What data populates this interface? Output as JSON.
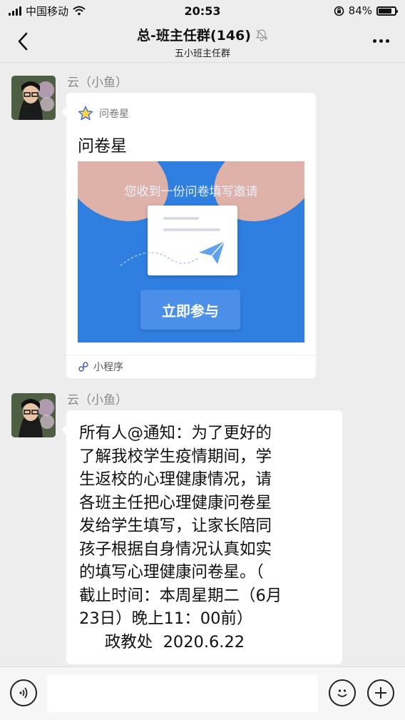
{
  "status_bar": {
    "carrier": "中国移动",
    "time": "20:53",
    "battery_percent": "84%",
    "battery_level": 0.84
  },
  "header": {
    "title": "总-班主任群(146)",
    "subtitle": "五小班主任群"
  },
  "messages": [
    {
      "sender": "云（小鱼）",
      "type": "mini_program",
      "app_name": "问卷星",
      "title": "问卷星",
      "thumb_text": "您收到一份问卷填写邀请",
      "thumb_button": "立即参与",
      "footer": "小程序"
    },
    {
      "sender": "云（小鱼）",
      "type": "text",
      "text": "所有人@通知：为了更好的\n了解我校学生疫情期间，学\n生返校的心理健康情况，请\n各班主任把心理健康问卷星\n发给学生填写，让家长陪同\n孩子根据自身情况认真如实\n的填写心理健康问卷星。（\n截止时间：本周星期二（6月\n23日）晚上11：00前）\n     政教处  2020.6.22"
    }
  ],
  "input_bar": {
    "placeholder": "",
    "value": ""
  },
  "icons": {
    "back": "chevron-left-icon",
    "mute": "bell-off-icon",
    "more": "more-dots-icon",
    "voice": "voice-icon",
    "emoji": "emoji-icon",
    "plus": "plus-icon",
    "app": "star-icon",
    "mini_program": "mini-program-icon"
  },
  "colors": {
    "background": "#ededed",
    "bubble": "#ffffff",
    "thumb_blue": "#2f7fe0",
    "sender_gray": "#8a8a8a"
  }
}
